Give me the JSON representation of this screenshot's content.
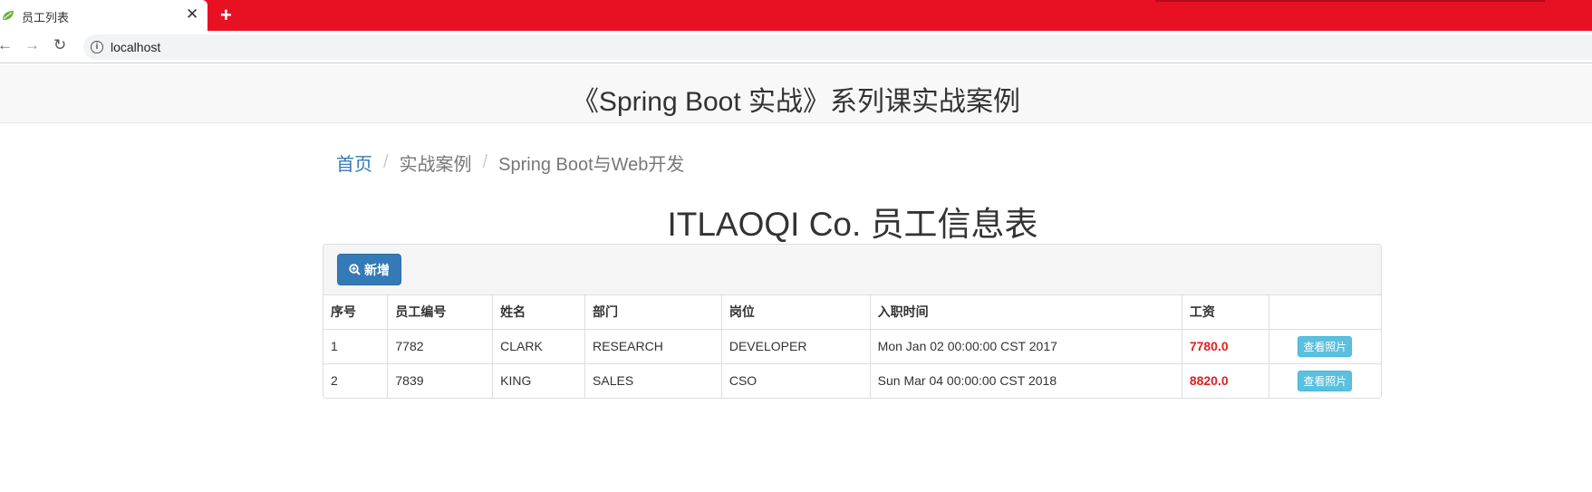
{
  "browser": {
    "tab_title": "员工列表",
    "tab_close": "✕",
    "new_tab": "+",
    "back": "←",
    "forward": "→",
    "reload": "↻",
    "info_glyph": "i",
    "url": "localhost"
  },
  "header": {
    "title": "《Spring Boot 实战》系列课实战案例"
  },
  "breadcrumb": {
    "items": [
      "首页",
      "实战案例",
      "Spring Boot与Web开发"
    ],
    "separator": "/"
  },
  "page": {
    "title": "ITLAOQI Co. 员工信息表"
  },
  "toolbar": {
    "add_label": "新增"
  },
  "table": {
    "headers": [
      "序号",
      "员工编号",
      "姓名",
      "部门",
      "岗位",
      "入职时间",
      "工资",
      ""
    ],
    "rows": [
      [
        "1",
        "7782",
        "CLARK",
        "RESEARCH",
        "DEVELOPER",
        "Mon Jan 02 00:00:00 CST 2017",
        "7780.0"
      ],
      [
        "2",
        "7839",
        "KING",
        "SALES",
        "CSO",
        "Sun Mar 04 00:00:00 CST 2018",
        "8820.0"
      ]
    ],
    "action_label": "查看照片"
  },
  "colors": {
    "tabstrip": "#e81123",
    "primary": "#337ab7",
    "info": "#5bc0de",
    "salary": "#e02020"
  }
}
